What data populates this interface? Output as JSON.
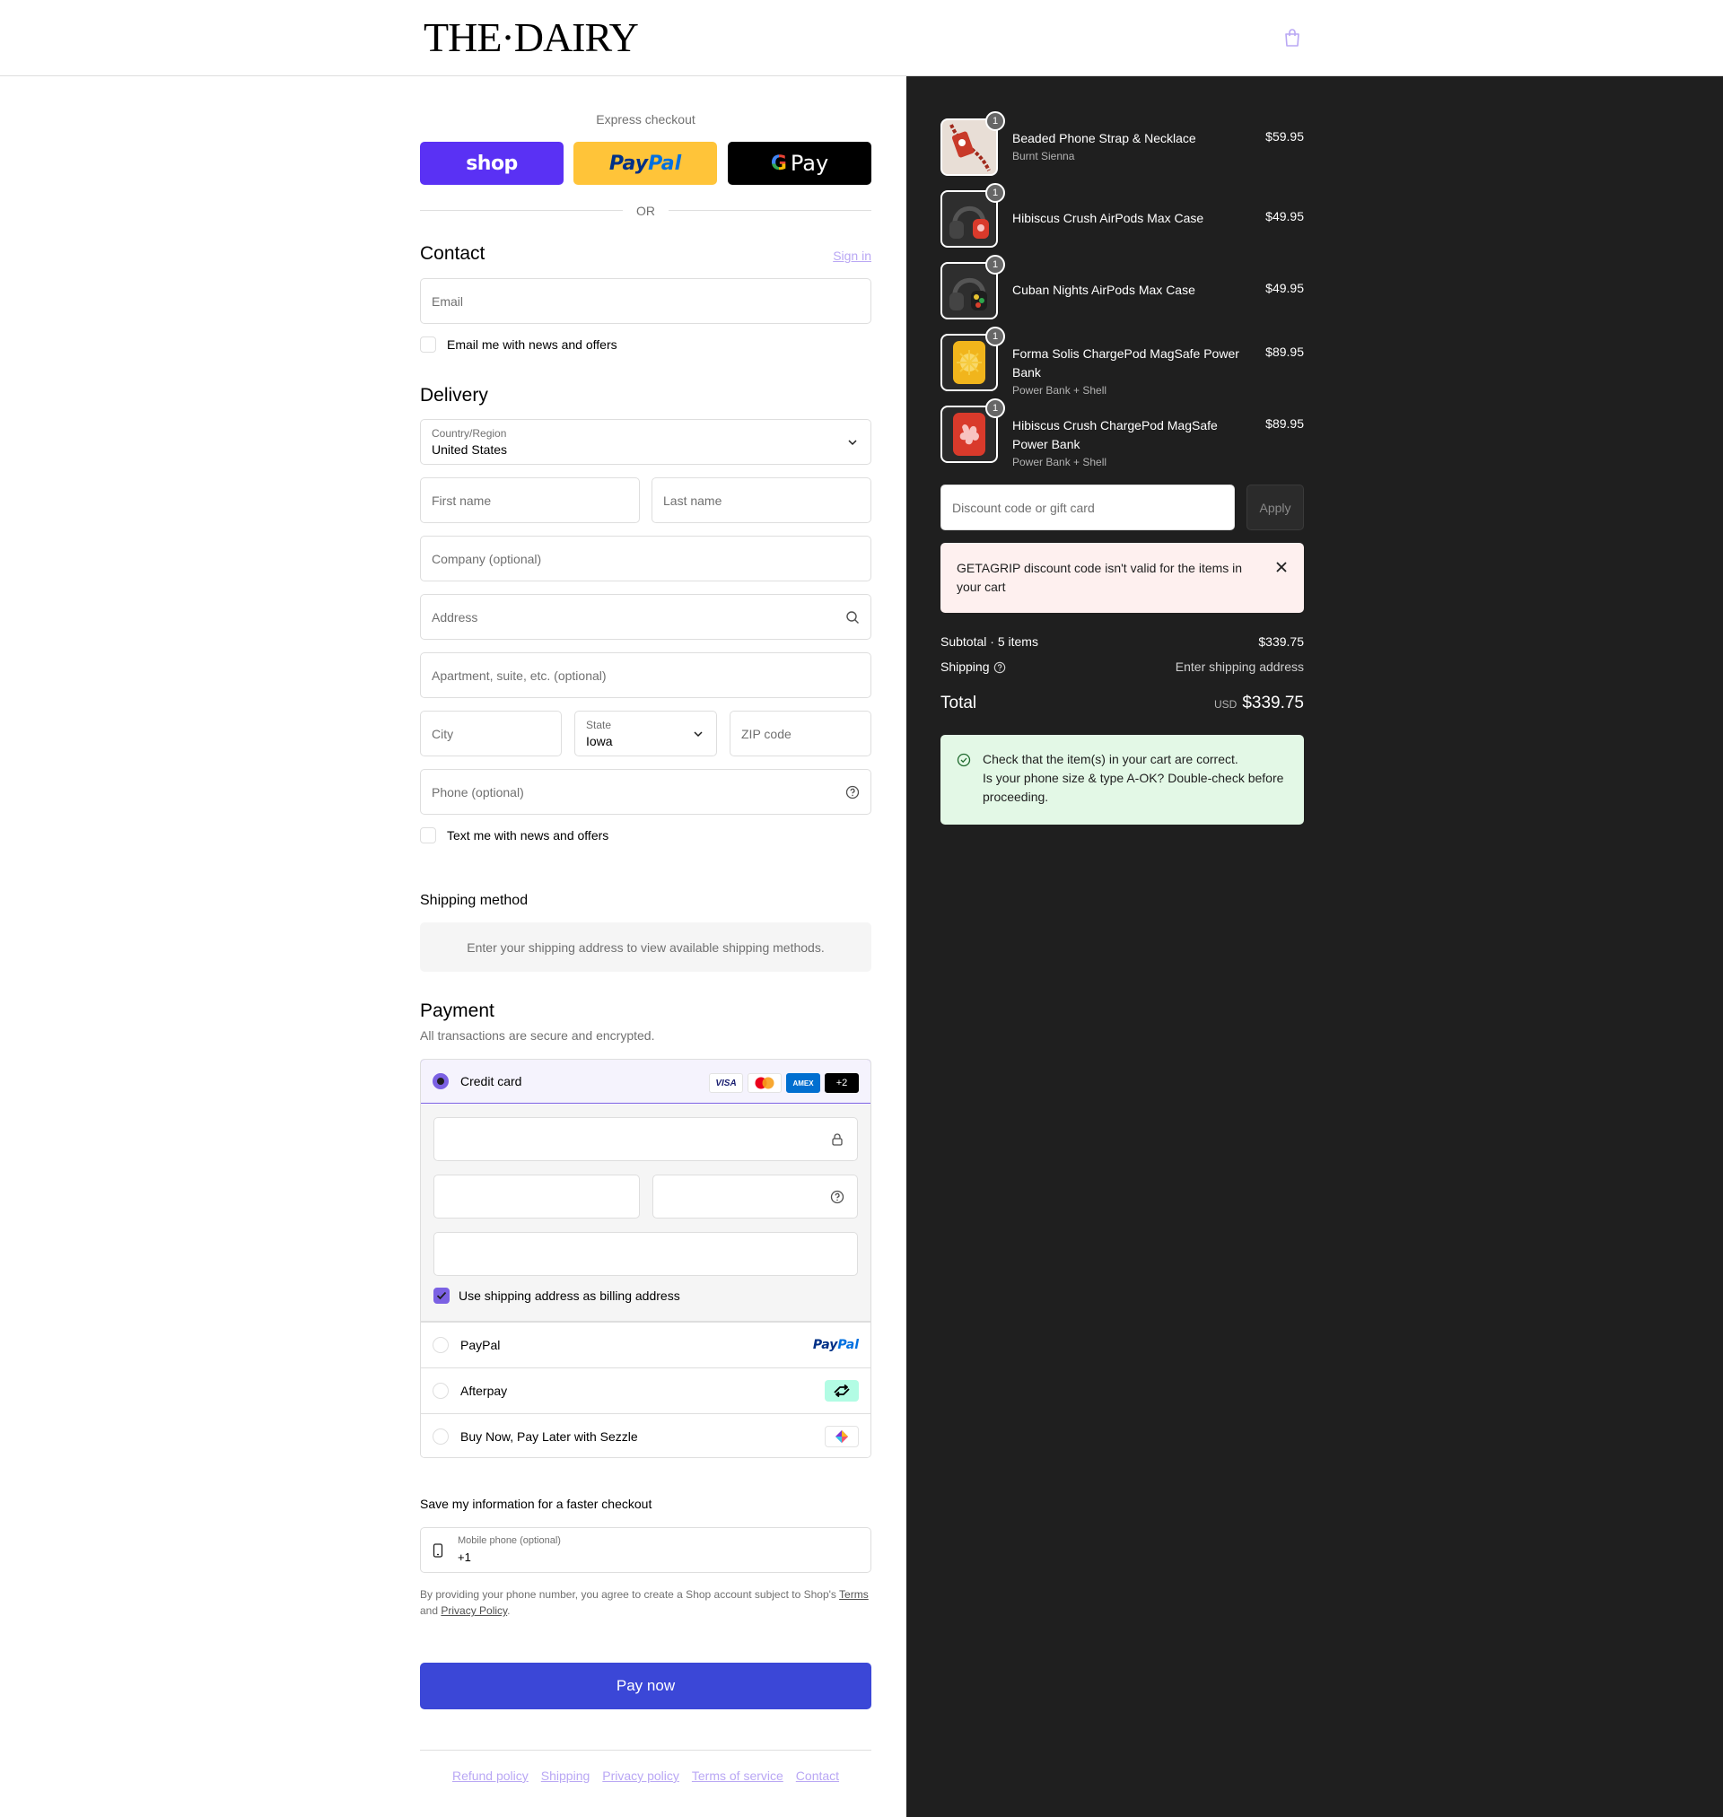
{
  "header": {
    "logo": "THE·DAIRY"
  },
  "express": {
    "title": "Express checkout",
    "shop_label": "shop",
    "paypal_part1": "Pay",
    "paypal_part2": "Pal",
    "gpay_g": "G",
    "gpay_label": "Pay",
    "or": "OR"
  },
  "contact": {
    "title": "Contact",
    "signin": "Sign in",
    "email_placeholder": "Email",
    "news_checkbox": "Email me with news and offers"
  },
  "delivery": {
    "title": "Delivery",
    "country_label": "Country/Region",
    "country_value": "United States",
    "first_name": "First name",
    "last_name": "Last name",
    "company": "Company (optional)",
    "address": "Address",
    "apartment": "Apartment, suite, etc. (optional)",
    "city": "City",
    "state_label": "State",
    "state_value": "Iowa",
    "zip": "ZIP code",
    "phone": "Phone (optional)",
    "text_checkbox": "Text me with news and offers"
  },
  "shipping": {
    "title": "Shipping method",
    "note": "Enter your shipping address to view available shipping methods."
  },
  "payment": {
    "title": "Payment",
    "subtitle": "All transactions are secure and encrypted.",
    "credit_card": "Credit card",
    "card_logos": [
      "VISA",
      "",
      "AMEX",
      "+2"
    ],
    "billing_checkbox": "Use shipping address as billing address",
    "paypal": "PayPal",
    "paypal_logo_1": "Pay",
    "paypal_logo_2": "Pal",
    "afterpay": "Afterpay",
    "sezzle": "Buy Now, Pay Later with Sezzle"
  },
  "save_info": {
    "title": "Save my information for a faster checkout",
    "mobile_label": "Mobile phone (optional)",
    "mobile_value": "+1",
    "legal_1": "By providing your phone number, you agree to create a Shop account subject to Shop's ",
    "legal_terms": "Terms",
    "legal_2": " and ",
    "legal_privacy": "Privacy Policy",
    "legal_3": "."
  },
  "pay_now": "Pay now",
  "footer": [
    "Refund policy",
    "Shipping",
    "Privacy policy",
    "Terms of service",
    "Contact"
  ],
  "cart": {
    "items": [
      {
        "qty": "1",
        "name": "Beaded Phone Strap & Necklace",
        "variant": "Burnt Sienna",
        "price": "$59.95"
      },
      {
        "qty": "1",
        "name": "Hibiscus Crush AirPods Max Case",
        "variant": "",
        "price": "$49.95"
      },
      {
        "qty": "1",
        "name": "Cuban Nights AirPods Max Case",
        "variant": "",
        "price": "$49.95"
      },
      {
        "qty": "1",
        "name": "Forma Solis ChargePod MagSafe Power Bank",
        "variant": "Power Bank + Shell",
        "price": "$89.95"
      },
      {
        "qty": "1",
        "name": "Hibiscus Crush ChargePod MagSafe Power Bank",
        "variant": "Power Bank + Shell",
        "price": "$89.95"
      }
    ],
    "discount_placeholder": "Discount code or gift card",
    "apply": "Apply",
    "error": "GETAGRIP discount code isn't valid for the items in your cart",
    "subtotal_label": "Subtotal · 5 items",
    "subtotal_value": "$339.75",
    "shipping_label": "Shipping",
    "shipping_value": "Enter shipping address",
    "total_label": "Total",
    "total_currency": "USD",
    "total_value": "$339.75",
    "note_line1": "Check that the item(s) in your cart are correct.",
    "note_line2": "Is your phone size & type A-OK? Double-check before proceeding."
  },
  "colors": {
    "accent": "#7b61e3",
    "pay_button": "#3b47d7",
    "shop_purple": "#5a31f4",
    "paypal_yellow": "#ffc439",
    "sidebar_bg": "#1f1f1f"
  }
}
